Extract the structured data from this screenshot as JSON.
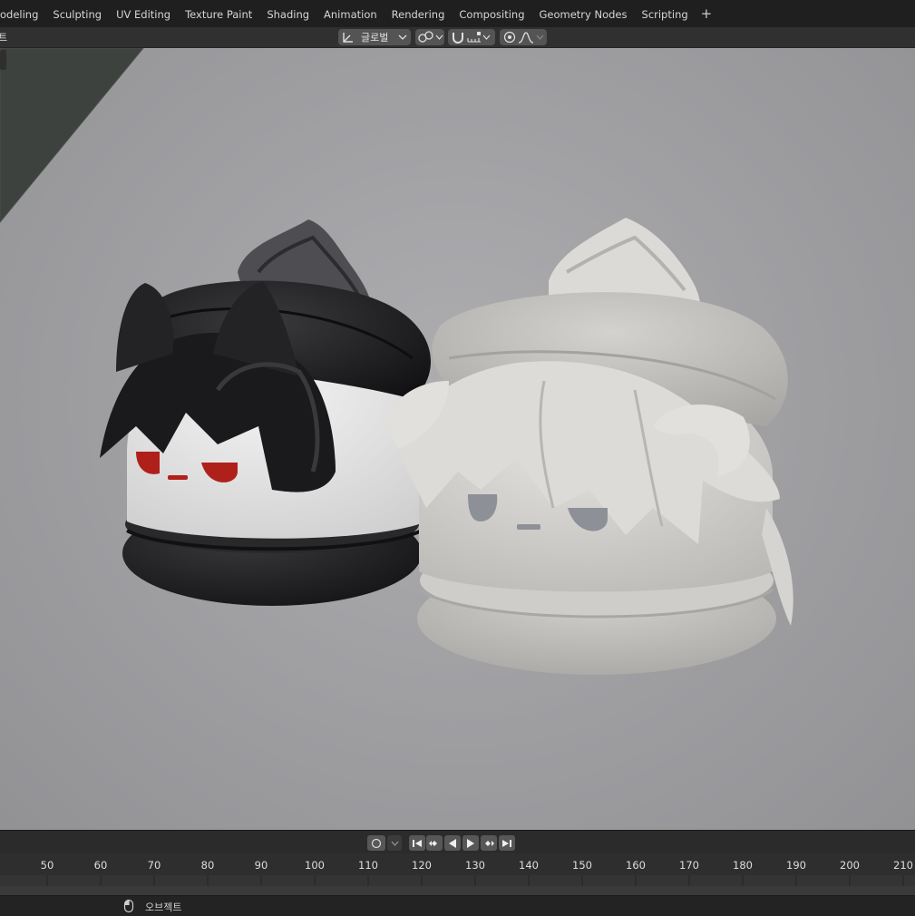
{
  "workspace_tabs": [
    "odeling",
    "Sculpting",
    "UV Editing",
    "Texture Paint",
    "Shading",
    "Animation",
    "Rendering",
    "Compositing",
    "Geometry Nodes",
    "Scripting"
  ],
  "add_tab_label": "+",
  "viewport_header": {
    "left_menu_glyph": "트",
    "transform_orientation": "글로벌"
  },
  "timeline": {
    "frame_labels": [
      "50",
      "60",
      "70",
      "80",
      "90",
      "100",
      "110",
      "120",
      "130",
      "140",
      "150",
      "160",
      "170",
      "180",
      "190",
      "200",
      "210"
    ]
  },
  "statusbar": {
    "mouse_hint": "오브젝트"
  },
  "colors": {
    "viewport_bg": "#a3a3a6",
    "black_model": "#1c1c1e",
    "white_model": "#d2d0cd",
    "eye_red": "#b0201b",
    "eye_grey": "#8d9096"
  }
}
